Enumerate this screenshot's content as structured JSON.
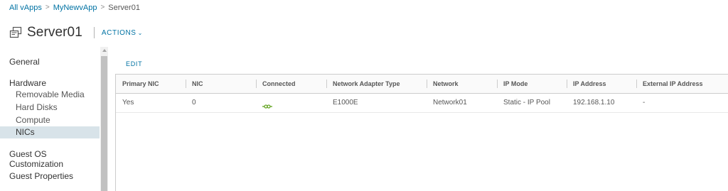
{
  "breadcrumb": {
    "items": [
      "All vApps",
      "MyNewvApp"
    ],
    "current": "Server01",
    "separator": ">"
  },
  "header": {
    "title": "Server01",
    "actions_label": "ACTIONS",
    "actions_caret": "⌄",
    "icon": "vm-icon"
  },
  "sidebar": {
    "general": "General",
    "hardware": "Hardware",
    "hardware_items": [
      "Removable Media",
      "Hard Disks",
      "Compute",
      "NICs"
    ],
    "selected": "NICs",
    "guest_os_customization": "Guest OS Customization",
    "guest_properties": "Guest Properties"
  },
  "toolbar": {
    "edit_label": "EDIT"
  },
  "table": {
    "columns": [
      "Primary NIC",
      "NIC",
      "Connected",
      "Network Adapter Type",
      "Network",
      "IP Mode",
      "IP Address",
      "External IP Address"
    ],
    "rows": [
      {
        "primary_nic": "Yes",
        "nic": "0",
        "connected_icon": "connected-icon",
        "adapter_type": "E1000E",
        "network": "Network01",
        "ip_mode": "Static - IP Pool",
        "ip_address": "192.168.1.10",
        "external_ip": "-"
      }
    ]
  },
  "colors": {
    "link": "#0072a3",
    "selected_bg": "#d8e3e9",
    "connected_green": "#62a420"
  }
}
